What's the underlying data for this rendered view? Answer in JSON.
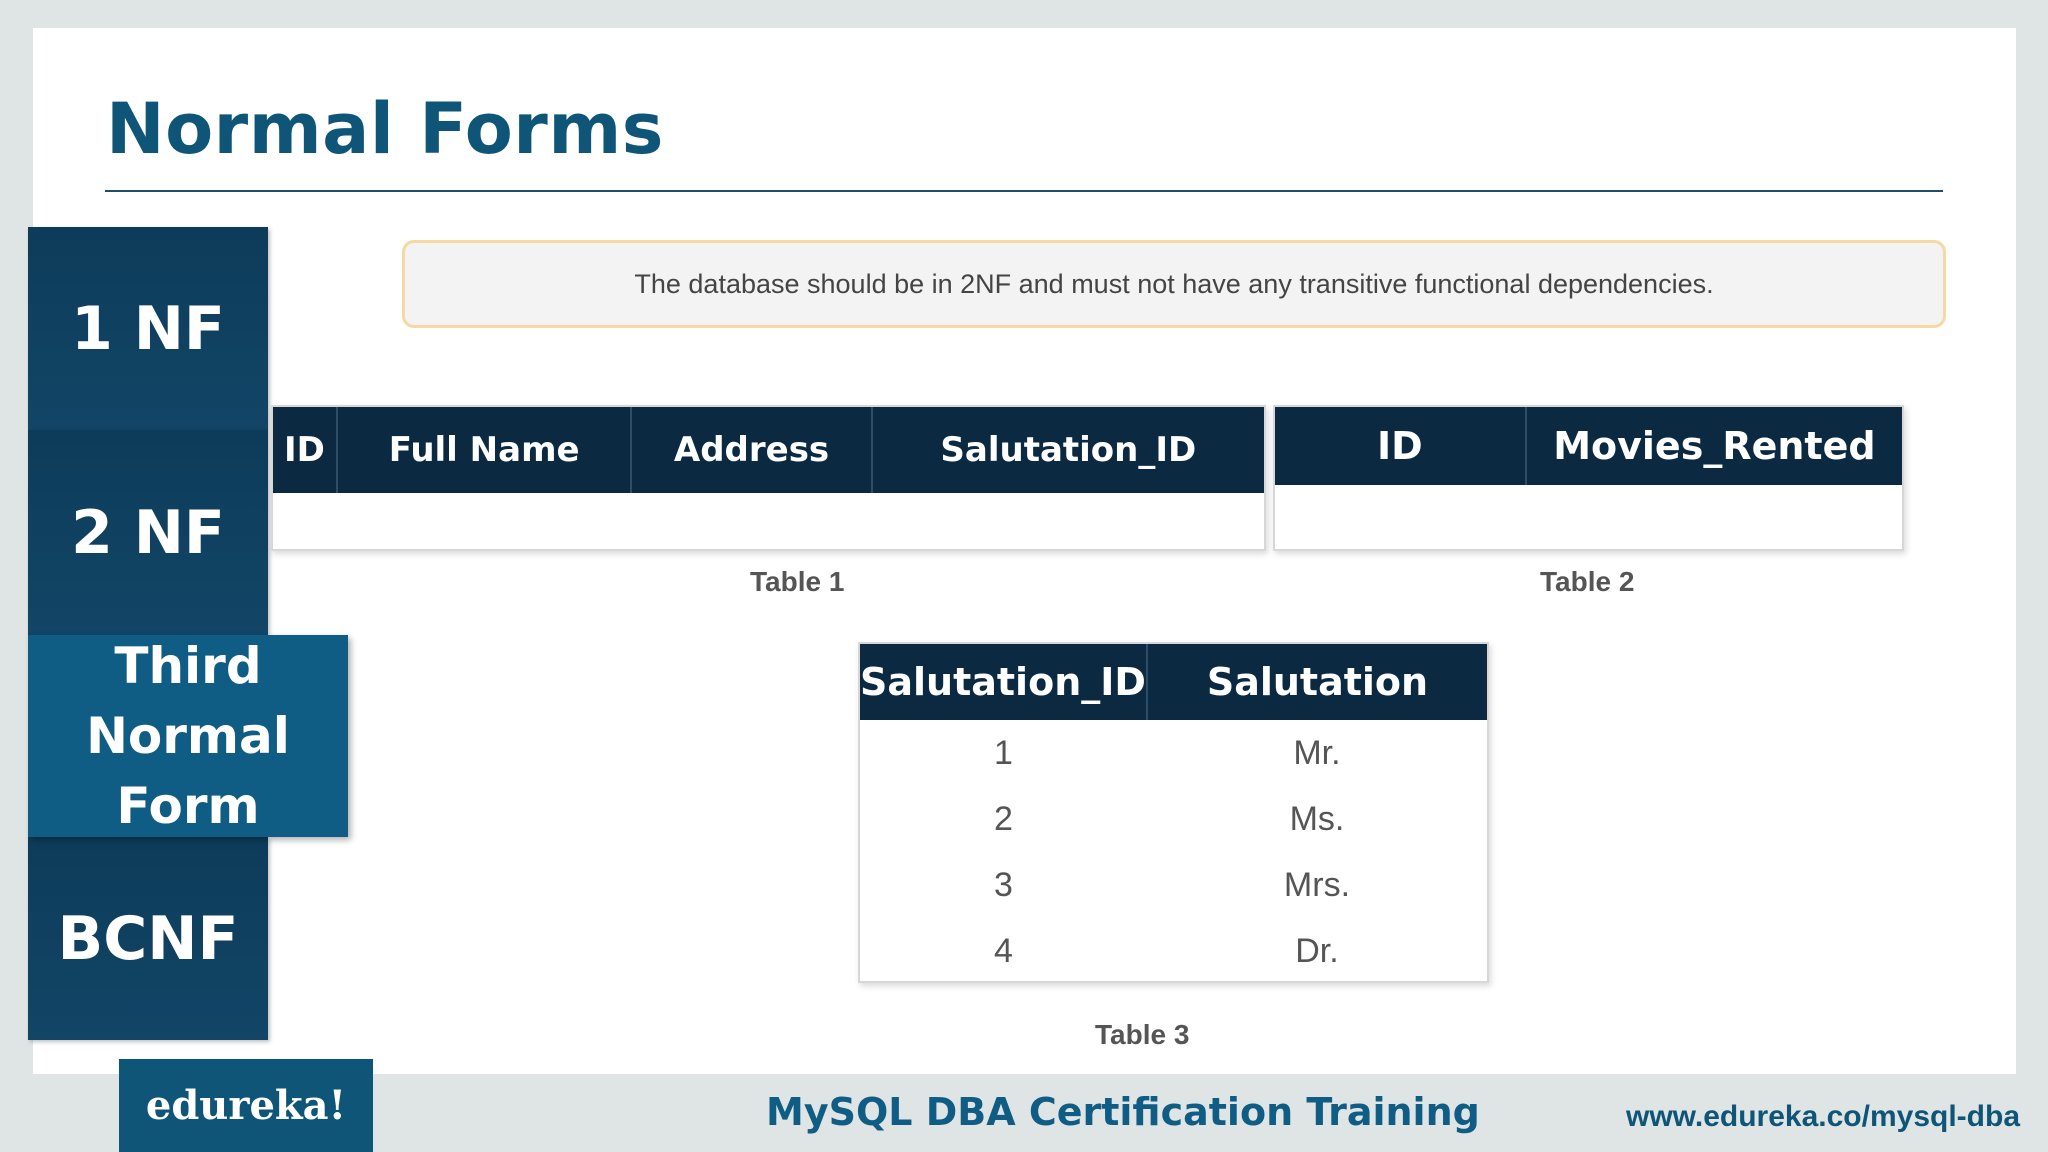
{
  "title": "Normal Forms",
  "nav": {
    "items": [
      "1 NF",
      "2 NF",
      "Third Normal Form",
      "BCNF"
    ],
    "active_line1": "Third",
    "active_line2": "Normal Form"
  },
  "definition": "The database should be in 2NF and  must not have any transitive functional dependencies.",
  "table1": {
    "caption": "Table 1",
    "headers": [
      "ID",
      "Full Name",
      "Address",
      "Salutation_ID"
    ]
  },
  "table2": {
    "caption": "Table 2",
    "headers": [
      "ID",
      "Movies_Rented"
    ]
  },
  "table3": {
    "caption": "Table 3",
    "headers": [
      "Salutation_ID",
      "Salutation"
    ],
    "rows": [
      [
        "1",
        "Mr."
      ],
      [
        "2",
        "Ms."
      ],
      [
        "3",
        "Mrs."
      ],
      [
        "4",
        "Dr."
      ]
    ]
  },
  "footer": {
    "logo": "edureka!",
    "course": "MySQL DBA Certification Training",
    "url": "www.edureka.co/mysql-dba"
  },
  "colors": {
    "primary": "#0f5577",
    "nav_dark": "#0d3c5a",
    "nav_active": "#0f5c85",
    "table_header": "#0b2a42",
    "definition_border": "#f5d9a0"
  }
}
